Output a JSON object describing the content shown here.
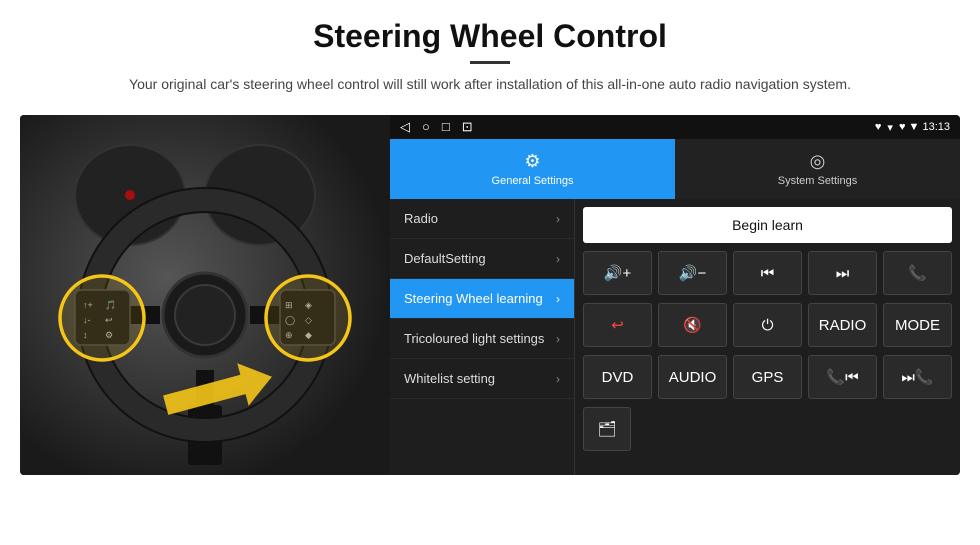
{
  "header": {
    "title": "Steering Wheel Control",
    "subtitle": "Your original car's steering wheel control will still work after installation of this all-in-one auto radio navigation system."
  },
  "status_bar": {
    "icons": [
      "◁",
      "○",
      "□",
      "⊡"
    ],
    "right": "♥  ▼  13:13"
  },
  "tabs": [
    {
      "label": "General Settings",
      "icon": "⚙",
      "active": true
    },
    {
      "label": "System Settings",
      "icon": "◎",
      "active": false
    }
  ],
  "menu": {
    "items": [
      {
        "label": "Radio",
        "active": false
      },
      {
        "label": "DefaultSetting",
        "active": false
      },
      {
        "label": "Steering Wheel learning",
        "active": true
      },
      {
        "label": "Tricoloured light settings",
        "active": false
      },
      {
        "label": "Whitelist setting",
        "active": false
      }
    ]
  },
  "controls": {
    "begin_learn_label": "Begin learn",
    "rows": [
      [
        {
          "type": "icon",
          "symbol": "🔊+"
        },
        {
          "type": "icon",
          "symbol": "🔊-"
        },
        {
          "type": "icon",
          "symbol": "⏮"
        },
        {
          "type": "icon",
          "symbol": "⏭"
        },
        {
          "type": "icon",
          "symbol": "📞"
        }
      ],
      [
        {
          "type": "icon",
          "symbol": "↩"
        },
        {
          "type": "icon",
          "symbol": "🔇"
        },
        {
          "type": "icon",
          "symbol": "⏻"
        },
        {
          "type": "text",
          "label": "RADIO"
        },
        {
          "type": "text",
          "label": "MODE"
        }
      ]
    ],
    "bottom_row": [
      {
        "label": "DVD"
      },
      {
        "label": "AUDIO"
      },
      {
        "label": "GPS"
      },
      {
        "label": "📞⏮"
      },
      {
        "label": "⏭📞"
      }
    ],
    "whitelist_icon": "🗂"
  }
}
